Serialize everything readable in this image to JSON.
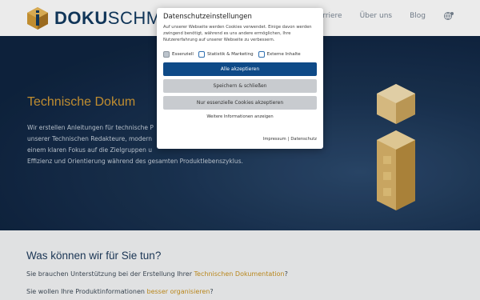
{
  "header": {
    "logo_bold": "DOKU",
    "logo_light": "SCHMI",
    "nav": [
      "Karriere",
      "Über uns",
      "Blog"
    ],
    "lang_icon": "globe-icon"
  },
  "hero": {
    "title": "Technische Dokum",
    "text_lines": [
      "Wir erstellen Anleitungen für technische P",
      "unserer Technischen Redakteure, modern",
      "einem klaren Fokus auf die Zielgruppen u",
      "Effizienz und Orientierung während des gesamten Produktlebenszyklus."
    ]
  },
  "section": {
    "title": "Was können wir für Sie tun?",
    "line1_prefix": "Sie brauchen Unterstützung bei der Erstellung Ihrer ",
    "line1_link": "Technischen Dokumentation",
    "line1_suffix": "?",
    "line2_prefix": "Sie wollen Ihre Produktinformationen ",
    "line2_link": "besser organisieren",
    "line2_suffix": "?"
  },
  "cookie": {
    "title": "Datenschutzeinstellungen",
    "description": "Auf unserer Webseite werden Cookies verwendet. Einige davon werden zwingend benötigt, während es uns andere ermöglichen, Ihre Nutzererfahrung auf unserer Webseite zu verbessern.",
    "options": [
      {
        "label": "Essenziell",
        "checked": true
      },
      {
        "label": "Statistik & Marketing",
        "checked": false
      },
      {
        "label": "Externe Inhalte",
        "checked": false
      }
    ],
    "accept_all": "Alle akzeptieren",
    "save_close": "Speichern & schließen",
    "essential_only": "Nur essenzielle Cookies akzeptieren",
    "more_info": "Weitere Informationen anzeigen",
    "imprint": "Impressum",
    "separator": "|",
    "privacy": "Datenschutz"
  },
  "colors": {
    "brand_navy": "#123a60",
    "accent_gold": "#d19a35",
    "primary_button": "#0e4a87"
  }
}
